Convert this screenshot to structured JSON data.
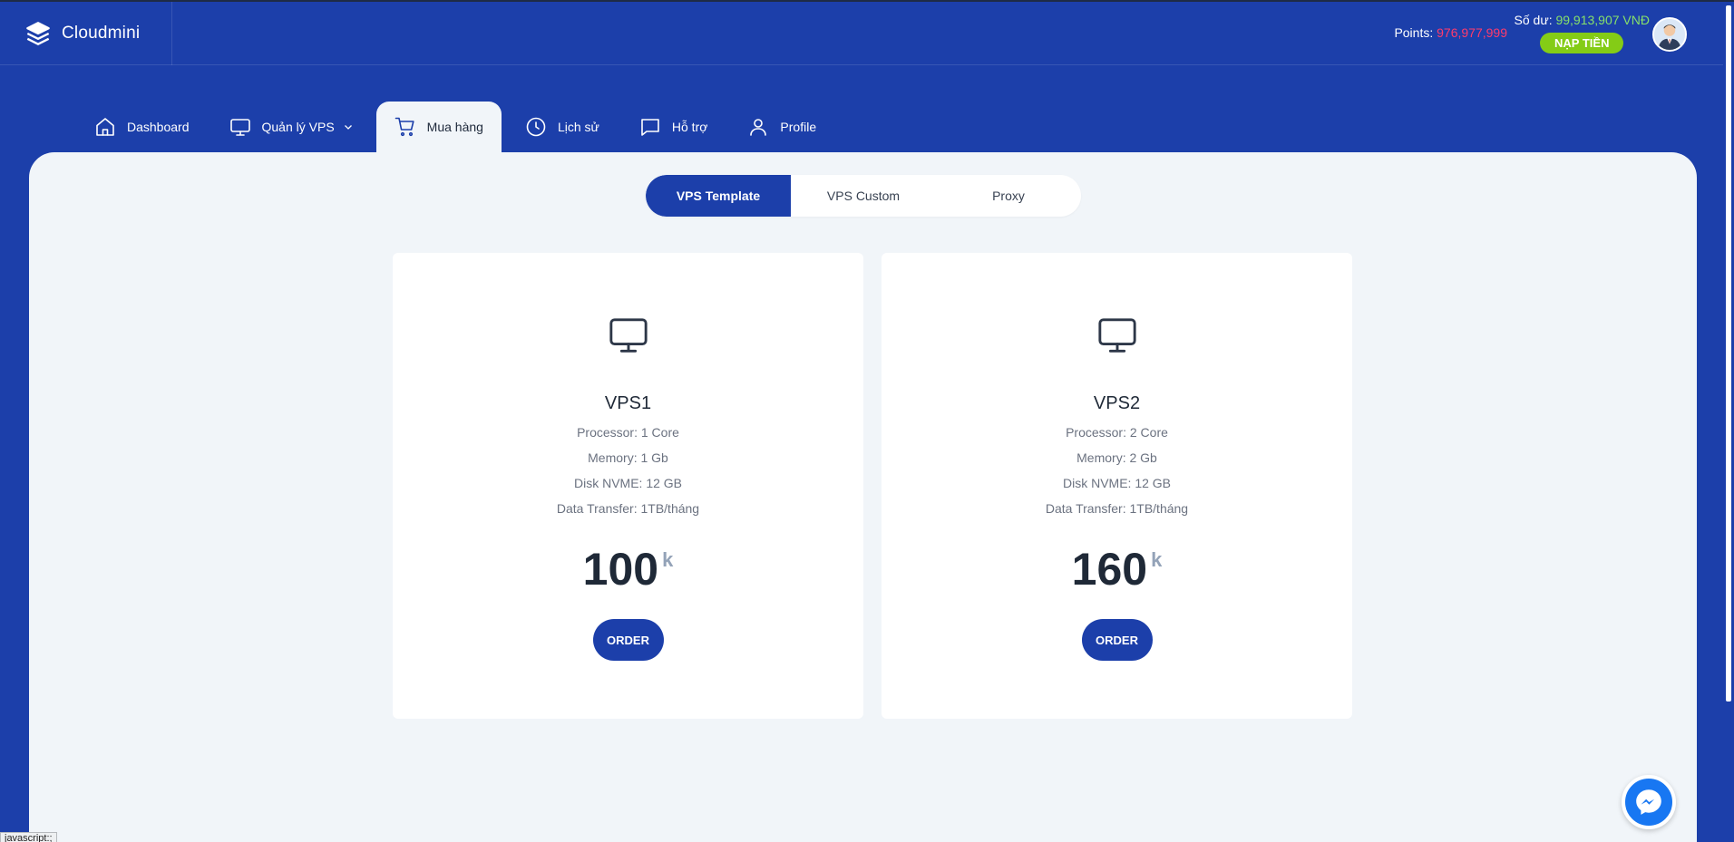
{
  "brand": {
    "name": "Cloudmini"
  },
  "header": {
    "points_label": "Points:",
    "points_value": "976,977,999",
    "balance_label": "Số dư:",
    "balance_value": "99,913,907 VNĐ",
    "topup_label": "NẠP TIỀN"
  },
  "nav": {
    "dashboard": "Dashboard",
    "vps": "Quản lý VPS",
    "shop": "Mua hàng",
    "history": "Lịch sử",
    "support": "Hỗ trợ",
    "profile": "Profile"
  },
  "tabs": {
    "template": "VPS Template",
    "custom": "VPS Custom",
    "proxy": "Proxy"
  },
  "plans": [
    {
      "name": "VPS1",
      "processor": "Processor: 1 Core",
      "memory": "Memory: 1 Gb",
      "disk": "Disk NVME: 12 GB",
      "transfer": "Data Transfer: 1TB/tháng",
      "price": "100",
      "unit": "k",
      "order": "ORDER"
    },
    {
      "name": "VPS2",
      "processor": "Processor: 2 Core",
      "memory": "Memory: 2 Gb",
      "disk": "Disk NVME: 12 GB",
      "transfer": "Data Transfer: 1TB/tháng",
      "price": "160",
      "unit": "k",
      "order": "ORDER"
    }
  ],
  "status_tip": "javascript:;",
  "colors": {
    "primary": "#1c3faa",
    "accent_green": "#84cc16",
    "points_red": "#ff3b6b",
    "balance_green": "#86e06a"
  }
}
